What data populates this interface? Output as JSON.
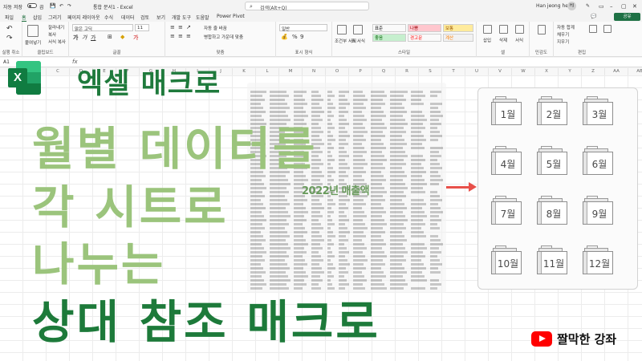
{
  "window": {
    "autosave_label": "자동 저장",
    "autosave_state": "끔",
    "file_title": "통합 문서1 - Excel",
    "search_placeholder": "검색(Alt+Q)",
    "user_name": "Han jeong hee",
    "user_initials": "HJ"
  },
  "menu": {
    "tabs": [
      "파일",
      "홈",
      "삽입",
      "그리기",
      "페이지 레이아웃",
      "수식",
      "데이터",
      "검토",
      "보기",
      "개발 도구",
      "도움말",
      "Power Pivot"
    ],
    "active_tab": "홈",
    "share_label": "공유"
  },
  "ribbon": {
    "undo_group": "실행 취소",
    "clipboard": {
      "label": "클립보드",
      "paste": "붙여넣기",
      "cut": "잘라내기",
      "copy": "복사",
      "format_painter": "서식 복사"
    },
    "font": {
      "label": "글꼴",
      "name": "맑은 고딕",
      "size": "11"
    },
    "alignment": {
      "label": "맞춤",
      "wrap": "자동 줄 바꿈",
      "merge": "병합하고 가운데 맞춤"
    },
    "number": {
      "label": "표시 형식",
      "format": "일반"
    },
    "styles": {
      "label": "스타일",
      "conditional": "조건부 서식",
      "table": "표 서식",
      "cells": [
        {
          "text": "표준",
          "bg": "#ffffff",
          "fg": "#333333"
        },
        {
          "text": "나쁨",
          "bg": "#ffc7ce",
          "fg": "#9c0006"
        },
        {
          "text": "보통",
          "bg": "#ffeb9c",
          "fg": "#9c5700"
        },
        {
          "text": "좋음",
          "bg": "#c6efce",
          "fg": "#006100"
        },
        {
          "text": "경고문",
          "bg": "#ffffff",
          "fg": "#ff0000"
        },
        {
          "text": "계산",
          "bg": "#f2f2f2",
          "fg": "#fa7d00"
        }
      ]
    },
    "cells_group": {
      "label": "셀",
      "insert": "삽입",
      "delete": "삭제",
      "format": "서식"
    },
    "editing": {
      "label": "편집",
      "autosum": "자동 합계",
      "fill": "채우기",
      "clear": "지우기",
      "sort": "정렬 및 필터",
      "find": "찾기 및 선택"
    },
    "analysis": "분석",
    "addins": "추가 기능",
    "sensitivity": "민감도"
  },
  "formula_bar": {
    "cell": "A1",
    "fx": "fx"
  },
  "columns": [
    "A",
    "B",
    "C",
    "D",
    "E",
    "F",
    "G",
    "H",
    "I",
    "J",
    "K",
    "L",
    "M",
    "N",
    "O",
    "P",
    "Q",
    "R",
    "S",
    "T",
    "U",
    "V",
    "W",
    "X",
    "Y",
    "Z",
    "AA",
    "AB"
  ],
  "data_caption": "2022년 매출액",
  "months": [
    "1월",
    "2월",
    "3월",
    "4월",
    "5월",
    "6월",
    "7월",
    "8월",
    "9월",
    "10월",
    "11월",
    "12월"
  ],
  "title": {
    "logo_letter": "X",
    "header": "엑셀 매크로",
    "lines": [
      "월별 데이터를",
      "각 시트로",
      "나누는",
      "상대 참조 매크로"
    ]
  },
  "channel": {
    "name": "짤막한 강좌",
    "icon": "youtube-icon"
  }
}
